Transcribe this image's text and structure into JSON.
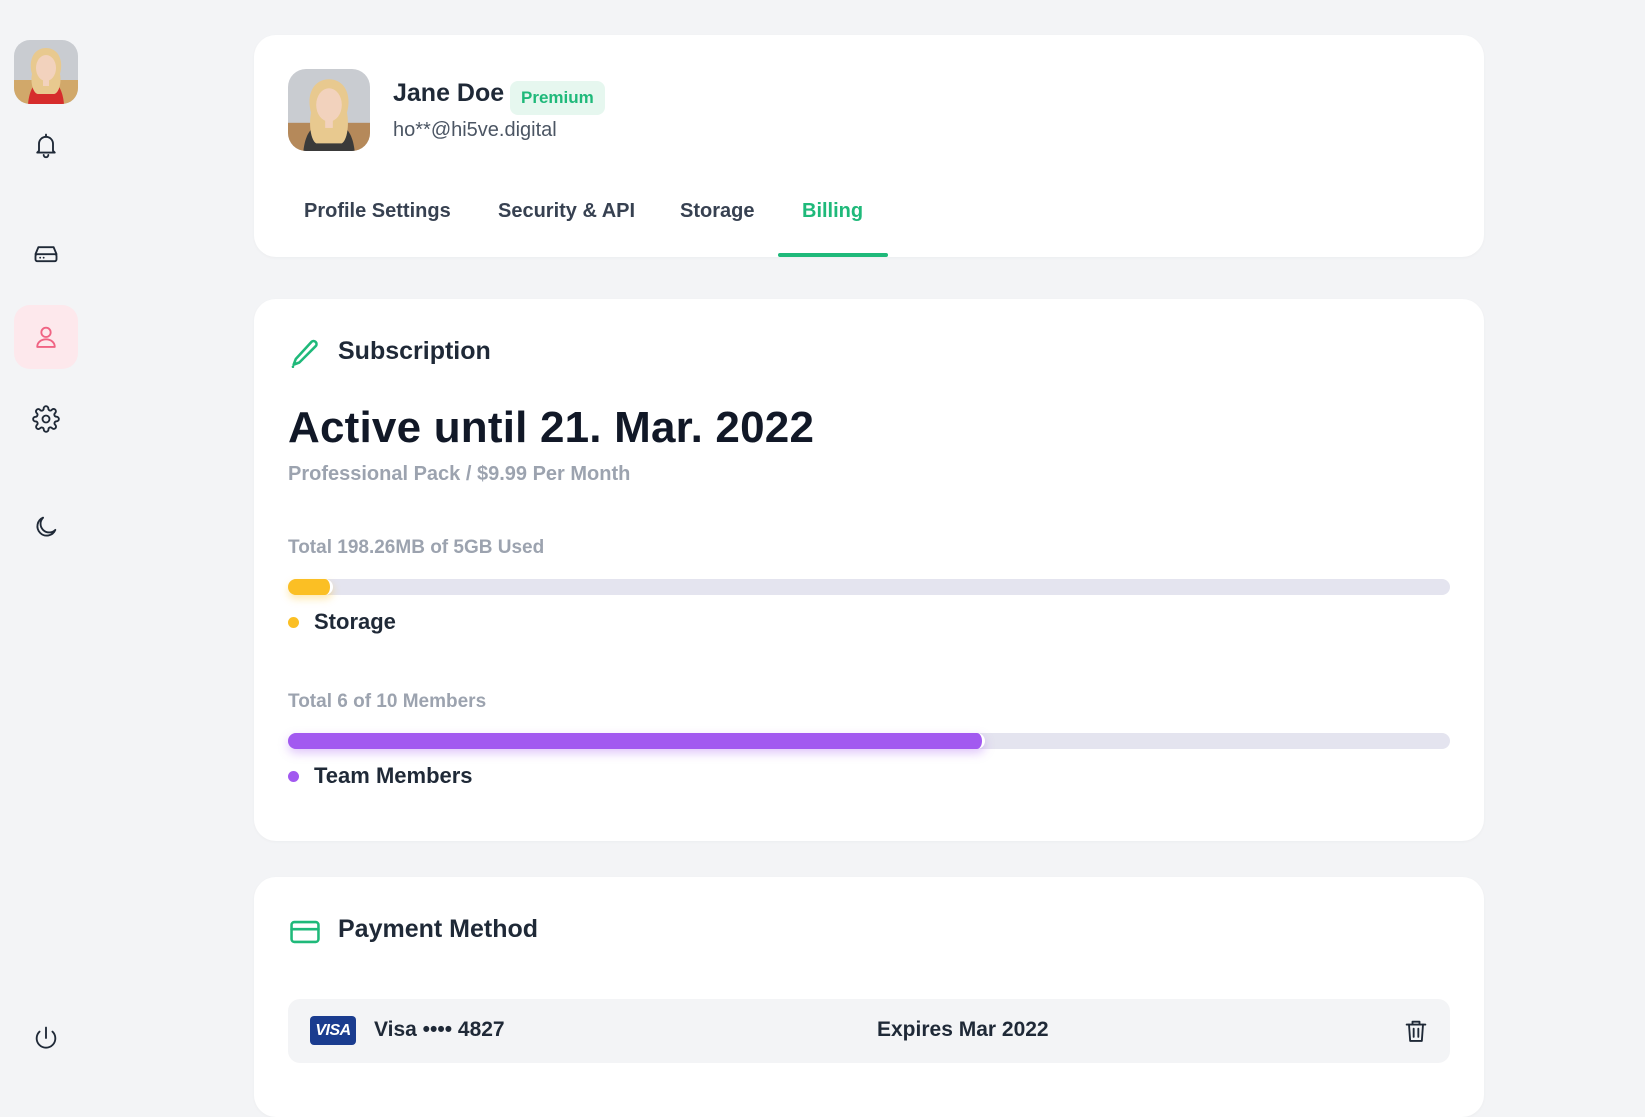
{
  "sidebar": {
    "items": [
      {
        "icon": "bell-icon"
      },
      {
        "icon": "hard-drive-icon"
      },
      {
        "icon": "user-icon",
        "active": true
      },
      {
        "icon": "gear-icon"
      },
      {
        "icon": "moon-icon"
      },
      {
        "icon": "power-icon"
      }
    ]
  },
  "profile": {
    "name": "Jane Doe",
    "badge": "Premium",
    "email": "ho**@hi5ve.digital"
  },
  "tabs": [
    {
      "label": "Profile Settings"
    },
    {
      "label": "Security & API"
    },
    {
      "label": "Storage"
    },
    {
      "label": "Billing",
      "active": true
    }
  ],
  "subscription": {
    "title": "Subscription",
    "status": "Active until 21. Mar. 2022",
    "plan": "Professional Pack / $9.99 Per Month",
    "storage": {
      "label": "Total 198.26MB of 5GB Used",
      "legend": "Storage",
      "fraction": 0.039,
      "color": "#fbbf24"
    },
    "members": {
      "label": "Total 6 of 10 Members",
      "legend": "Team Members",
      "fraction": 0.6,
      "color": "#a259f0"
    }
  },
  "payment": {
    "title": "Payment Method",
    "card_brand": "VISA",
    "card_number": "Visa •••• 4827",
    "expiry": "Expires Mar 2022"
  },
  "colors": {
    "accent": "#1fb97a",
    "active_nav_bg": "#fde8ec",
    "active_nav_icon": "#f06383"
  }
}
